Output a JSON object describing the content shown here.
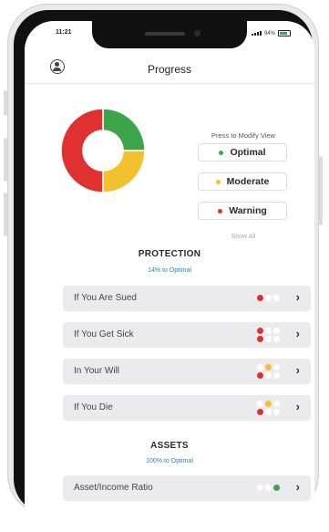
{
  "status_bar": {
    "time": "11:21",
    "battery": "94%"
  },
  "header": {
    "title": "Progress"
  },
  "chart_data": {
    "type": "pie",
    "categories": [
      "Optimal",
      "Moderate",
      "Warning"
    ],
    "values": [
      25,
      25,
      50
    ],
    "colors": [
      "#3ca54a",
      "#f2c12e",
      "#e03131"
    ]
  },
  "legend": {
    "hint": "Press to Modify View",
    "items": [
      {
        "label": "Optimal",
        "color": "#3ca54a"
      },
      {
        "label": "Moderate",
        "color": "#f2c12e"
      },
      {
        "label": "Warning",
        "color": "#e03131"
      }
    ],
    "show_all": "Show All"
  },
  "protection": {
    "title": "PROTECTION",
    "subtitle": "14% to Optimal",
    "rows": [
      {
        "label": "If You Are Sued",
        "dots": [
          [
            "#e03131",
            "#ffffff",
            "#ffffff"
          ]
        ]
      },
      {
        "label": "If You Get Sick",
        "dots": [
          [
            "#e03131",
            "#ffffff",
            "#ffffff"
          ],
          [
            "#e03131",
            "#ffffff",
            "#ffffff"
          ]
        ]
      },
      {
        "label": "In Your Will",
        "dots": [
          [
            "#ffffff",
            "#f2c12e",
            "#ffffff"
          ],
          [
            "#e03131",
            "#ffffff",
            "#ffffff"
          ]
        ]
      },
      {
        "label": "If You Die",
        "dots": [
          [
            "#ffffff",
            "#f2c12e",
            "#ffffff"
          ],
          [
            "#e03131",
            "#ffffff",
            "#ffffff"
          ]
        ]
      }
    ]
  },
  "assets": {
    "title": "ASSETS",
    "subtitle": "100% to Optimal",
    "rows": [
      {
        "label": "Asset/Income Ratio",
        "dots": [
          [
            "#ffffff",
            "#ffffff",
            "#3ca54a"
          ]
        ]
      }
    ]
  },
  "colors": {
    "accent": "#2a7fd0",
    "row_bg": "#ebebed"
  }
}
